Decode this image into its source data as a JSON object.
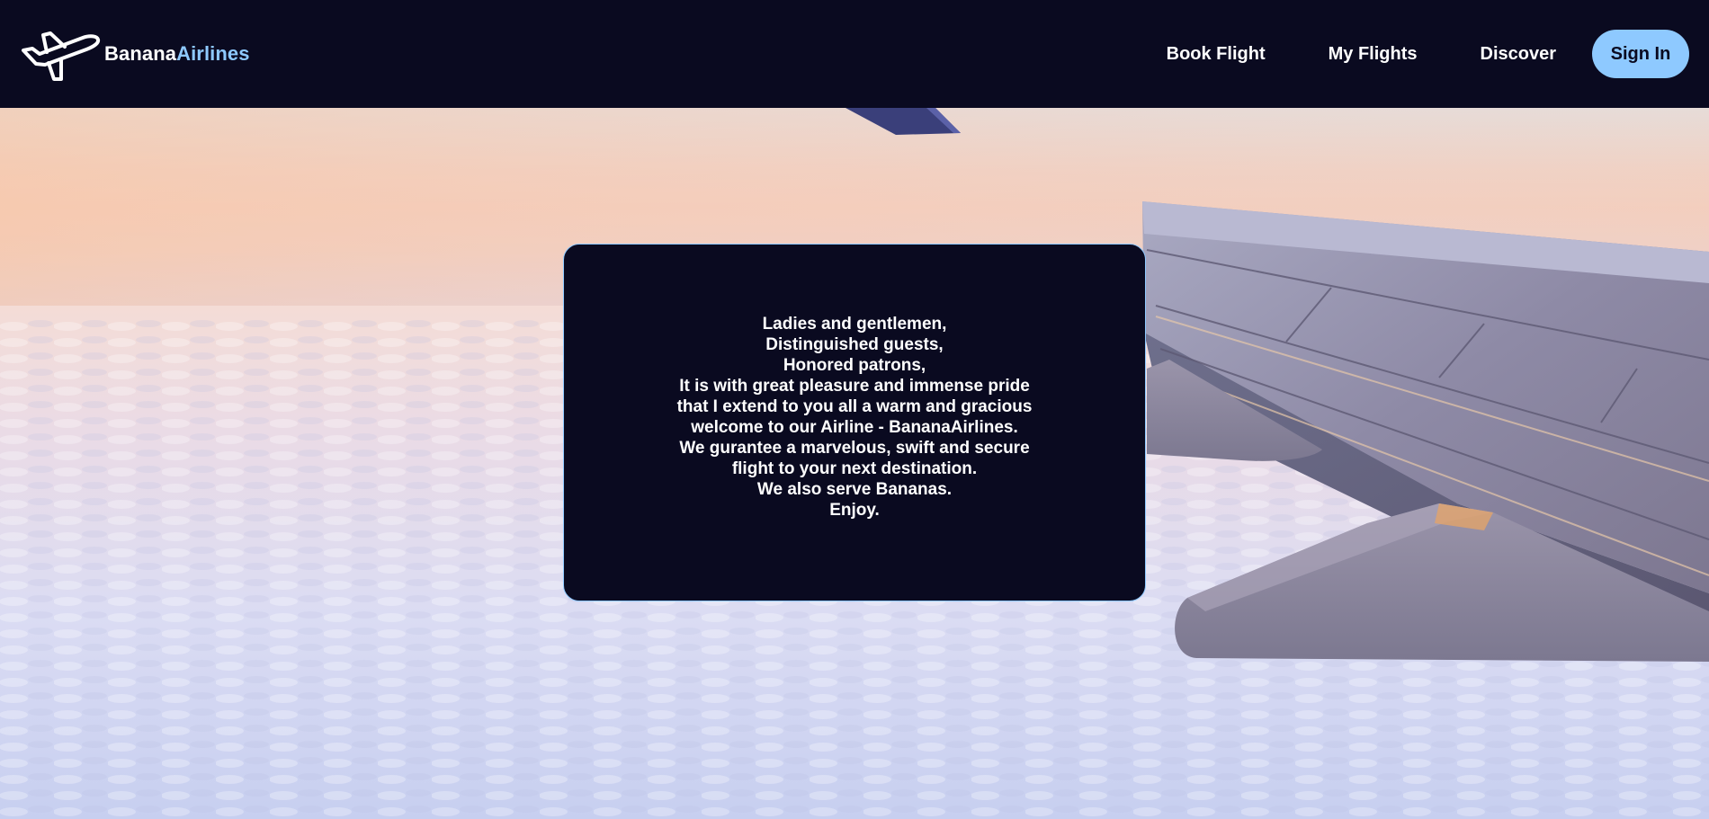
{
  "brand": {
    "name_part1": "Banana",
    "name_part2": "Airlines",
    "logo_icon": "airplane-icon"
  },
  "nav": {
    "links": [
      {
        "label": "Book Flight"
      },
      {
        "label": "My Flights"
      },
      {
        "label": "Discover"
      }
    ],
    "signin_label": "Sign In"
  },
  "hero": {
    "background": "airplane-wing-above-clouds",
    "message_lines": [
      "Ladies and gentlemen,",
      "Distinguished guests,",
      "Honored patrons,",
      "It is with great pleasure and immense pride",
      "that I extend to you all a warm and gracious",
      "welcome to our Airline - BananaAirlines.",
      "We gurantee a marvelous, swift and secure",
      "flight to your next destination.",
      "We also serve Bananas.",
      "Enjoy."
    ]
  },
  "colors": {
    "navbar_bg": "#0a0a20",
    "accent": "#8ec9ff",
    "text": "#ffffff"
  }
}
